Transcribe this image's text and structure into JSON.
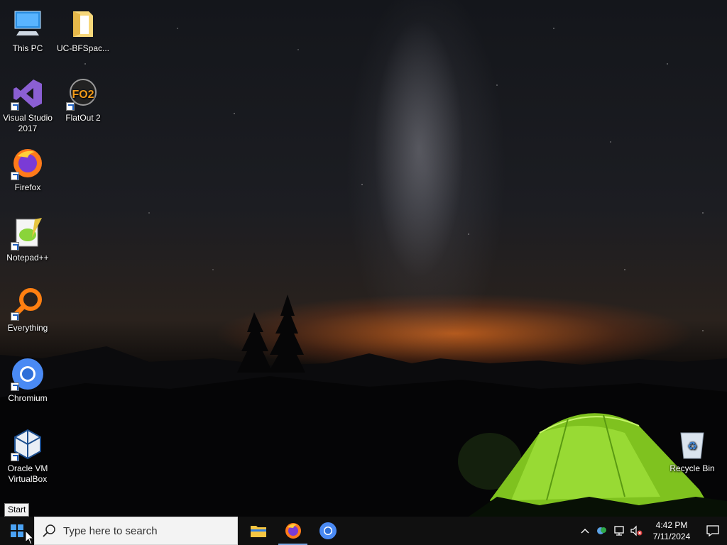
{
  "desktop": {
    "icons": [
      {
        "label": "This PC",
        "icon": "computer-icon"
      },
      {
        "label": "UC-BFSpac...",
        "icon": "folder-icon"
      },
      {
        "label": "Visual Studio 2017",
        "icon": "visual-studio-icon"
      },
      {
        "label": "FlatOut 2",
        "icon": "flatout-icon"
      },
      {
        "label": "Firefox",
        "icon": "firefox-icon"
      },
      {
        "label": "Notepad++",
        "icon": "notepad-plus-plus-icon"
      },
      {
        "label": "Everything",
        "icon": "everything-search-icon"
      },
      {
        "label": "Chromium",
        "icon": "chromium-icon"
      },
      {
        "label": "Oracle VM VirtualBox",
        "icon": "virtualbox-icon"
      },
      {
        "label": "Recycle Bin",
        "icon": "recycle-bin-icon"
      }
    ]
  },
  "tooltip": {
    "text": "Start"
  },
  "taskbar": {
    "search_placeholder": "Type here to search",
    "pinned": [
      "file-explorer-icon",
      "firefox-icon",
      "chromium-icon"
    ],
    "active_app": "firefox",
    "tray": [
      "chevron-up-icon",
      "onedrive-icon",
      "network-icon",
      "volume-muted-icon"
    ],
    "time": "4:42 PM",
    "date": "7/11/2024"
  },
  "colors": {
    "taskbar": "#101010",
    "tent": "#8bd62a",
    "horizon_glow": "#e0701e"
  }
}
